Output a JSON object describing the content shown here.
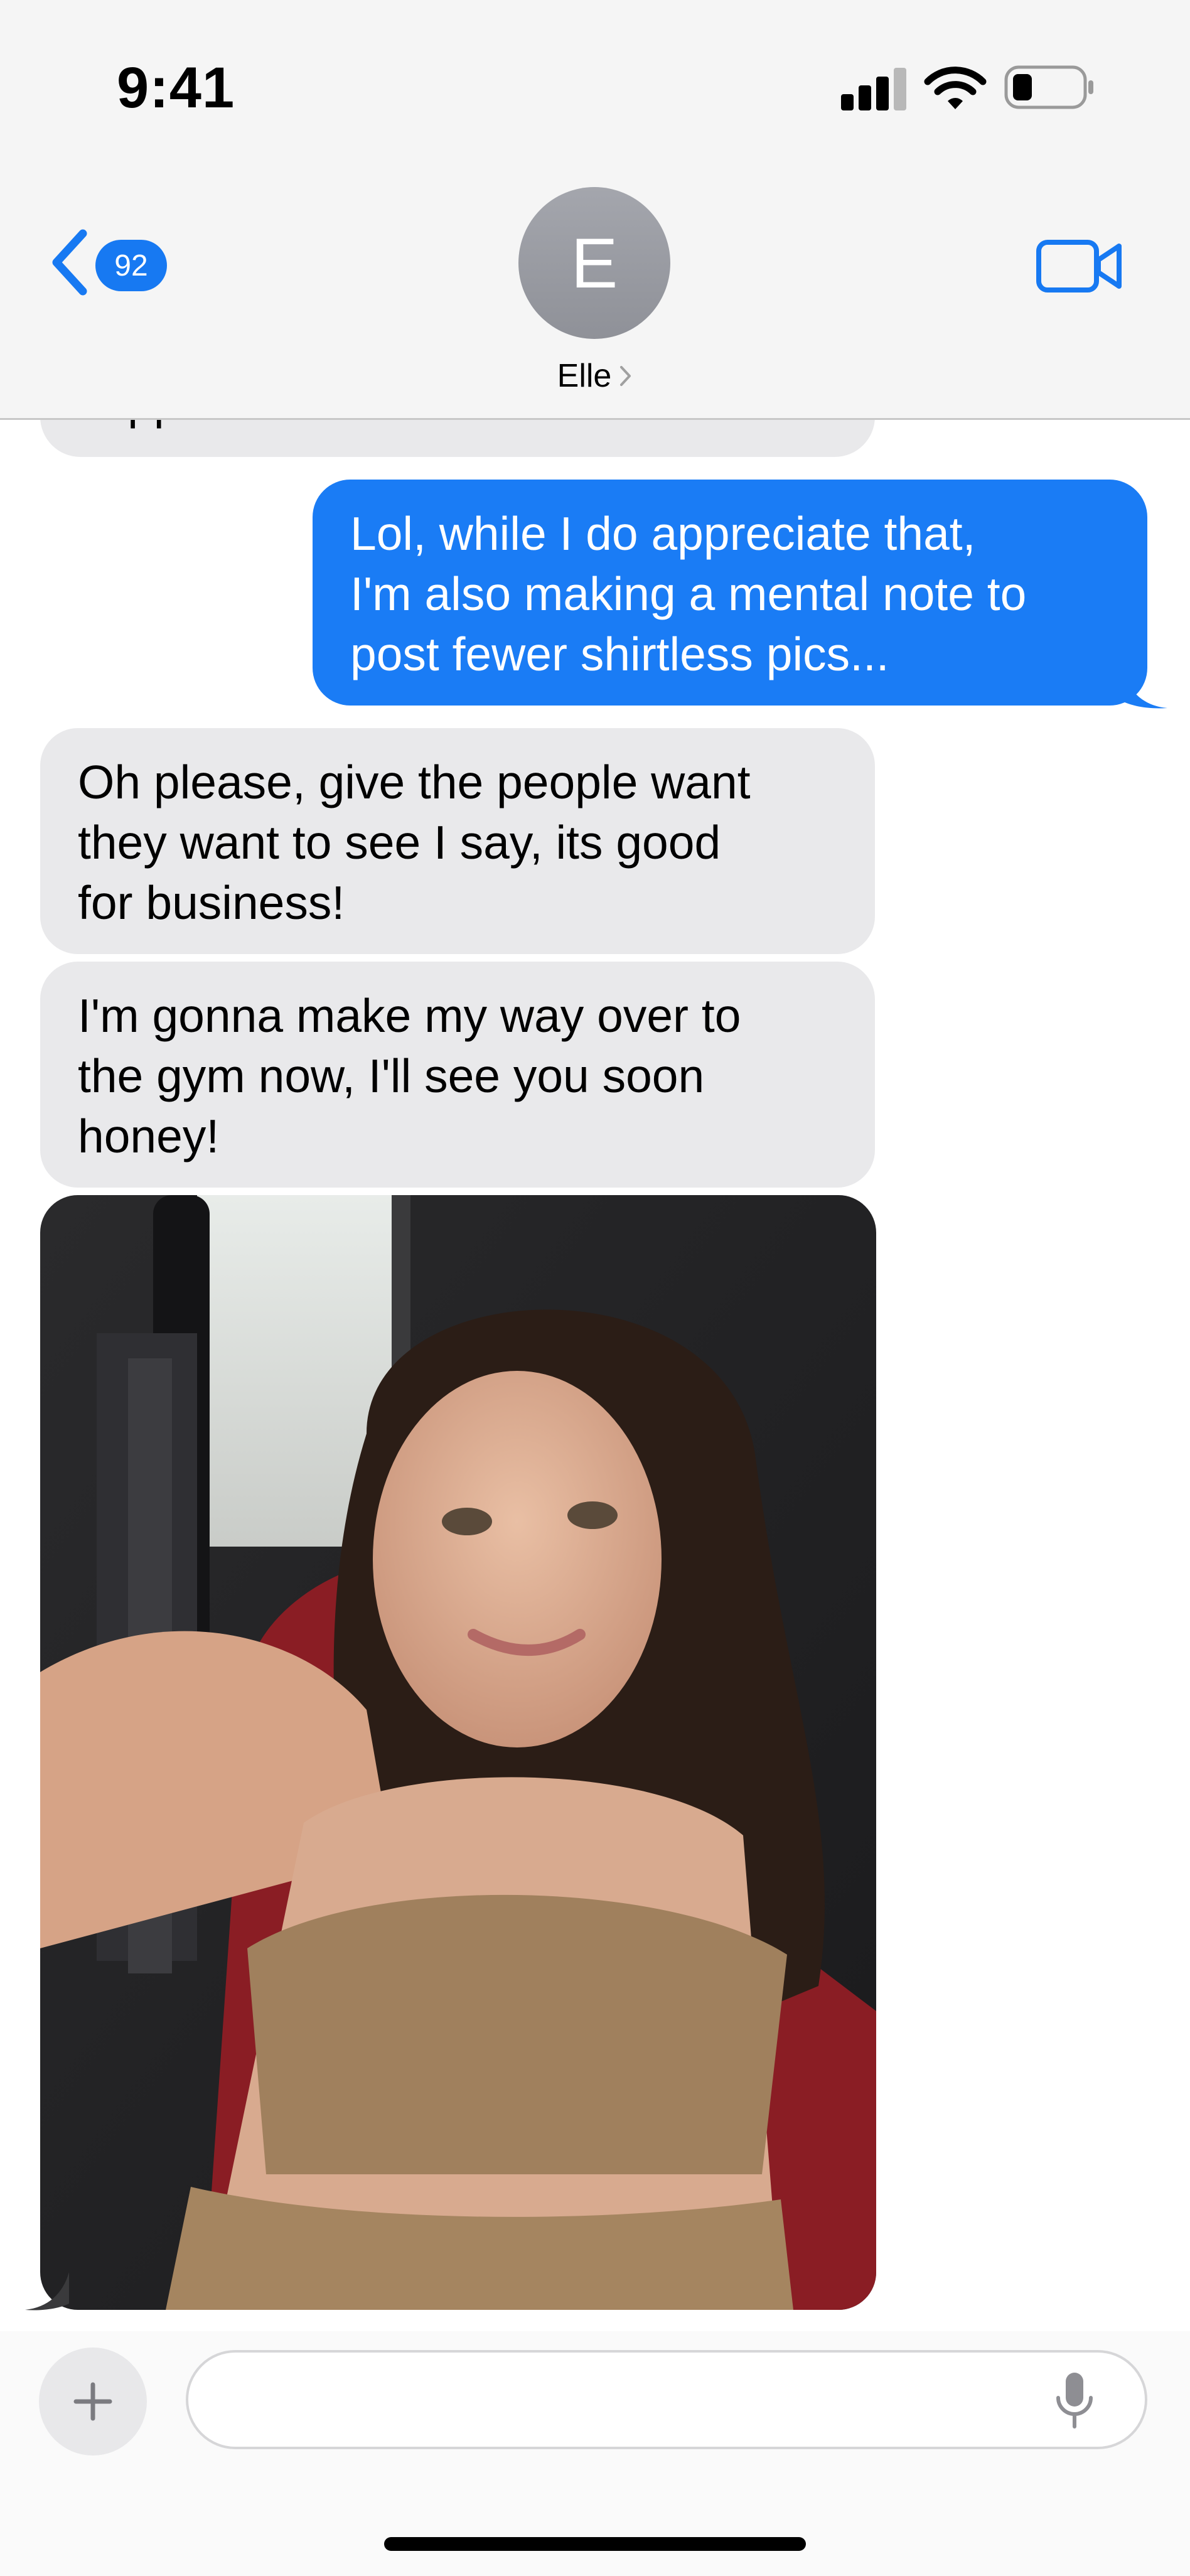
{
  "status_bar": {
    "time": "9:41",
    "icons": [
      "cellular-signal-icon",
      "wifi-icon",
      "battery-icon"
    ]
  },
  "nav": {
    "back_icon": "chevron-left-icon",
    "unread_count": "92",
    "avatar_initial": "E",
    "contact_name": "Elle",
    "contact_chevron": "›",
    "video_icon": "video-camera-icon"
  },
  "messages": [
    {
      "direction": "incoming",
      "lines": [
        "supported!"
      ],
      "partial": true
    },
    {
      "direction": "outgoing",
      "lines": [
        "Lol, while I do appreciate that,",
        "I'm also making a mental note to",
        "post fewer shirtless pics..."
      ]
    },
    {
      "direction": "incoming",
      "lines": [
        "Oh please, give the people want",
        "they want to see I say, its good",
        "for business!"
      ]
    },
    {
      "direction": "incoming",
      "lines": [
        "I'm gonna make my way over to",
        "the gym now, I'll see you soon",
        "honey!"
      ]
    },
    {
      "direction": "incoming",
      "type": "photo",
      "description": "selfie photo attachment"
    }
  ],
  "composer": {
    "plus_icon": "plus-icon",
    "placeholder": "",
    "value": "",
    "mic_icon": "microphone-icon"
  },
  "colors": {
    "outgoing_bubble": "#1a7cf5",
    "incoming_bubble": "#e9e9eb",
    "accent": "#1779f2",
    "header_bg": "#f5f5f5"
  }
}
